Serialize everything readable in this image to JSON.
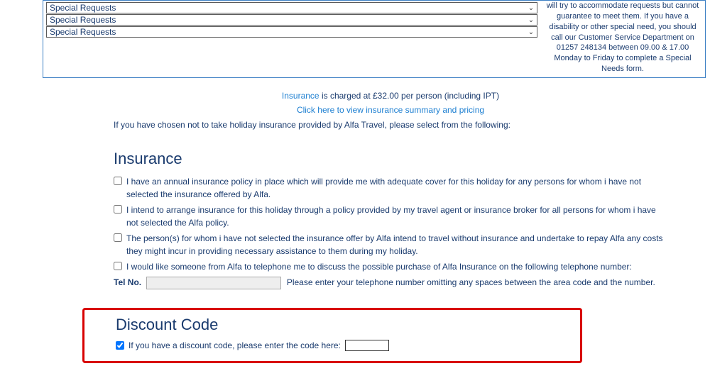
{
  "specialRequests": {
    "rows": [
      {
        "label": "Special Requests"
      },
      {
        "label": "Special Requests"
      },
      {
        "label": "Special Requests"
      }
    ]
  },
  "sidebarNote": "will try to accommodate requests but cannot guarantee to meet them. If you have a disability or other special need, you should call our Customer Service Department on 01257 248134 between 09.00 & 17.00 Monday to Friday to complete a Special Needs form.",
  "insuranceIntro": {
    "link": "Insurance",
    "rest": " is charged at £32.00 per person (including IPT)"
  },
  "insuranceSummaryLink": "Click here to view insurance summary and pricing",
  "notTakingText": "If you have chosen not to take holiday insurance provided by Alfa Travel, please select from the following:",
  "insuranceHeading": "Insurance",
  "options": {
    "opt1": "I have an annual insurance policy in place which will provide me with adequate cover for this holiday for any persons for whom i have not selected the insurance offered by Alfa.",
    "opt2": "I intend to arrange insurance for this holiday through a policy provided by my travel agent or insurance broker for all persons for whom i have not selected the Alfa policy.",
    "opt3": "The person(s) for whom i have not selected the insurance offer by Alfa intend to travel without insurance and undertake to repay Alfa any costs they might incur in providing necessary assistance to them during my holiday.",
    "opt4": "I would like someone from Alfa to telephone me to discuss the possible purchase of Alfa Insurance on the following telephone number:"
  },
  "telRow": {
    "label": "Tel No.",
    "placeholder": "",
    "after": "Please enter your telephone number omitting any spaces between the area code and the number."
  },
  "discount": {
    "heading": "Discount Code",
    "prompt": "If you have a discount code, please enter the code here:",
    "checked": true
  }
}
